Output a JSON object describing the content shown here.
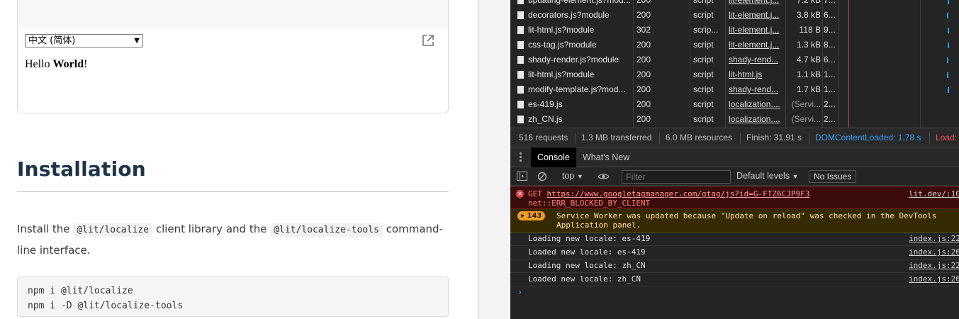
{
  "demo": {
    "locale_select_value": "中文 (简体)",
    "hello_prefix": "Hello ",
    "hello_bold": "World",
    "hello_suffix": "!"
  },
  "installation": {
    "heading": "Installation",
    "text_1": "Install the ",
    "code_1": "@lit/localize",
    "text_2": " client library and the ",
    "code_2": "@lit/localize-tools",
    "text_3": " command-line interface.",
    "code_block_lines": [
      "npm i @lit/localize",
      "npm i -D @lit/localize-tools"
    ]
  },
  "network": {
    "rows": [
      {
        "name": "updating-element.js?mod...",
        "status": "200",
        "type": "script",
        "initiator": "lit-element.j...",
        "size": "7.2 kB",
        "time": "7..."
      },
      {
        "name": "decorators.js?module",
        "status": "200",
        "type": "script",
        "initiator": "lit-element.j...",
        "size": "3.8 kB",
        "time": "6..."
      },
      {
        "name": "lit-html.js?module",
        "status": "302",
        "type": "scrip...",
        "initiator": "lit-element.j...",
        "size": "118 B",
        "time": "9..."
      },
      {
        "name": "css-tag.js?module",
        "status": "200",
        "type": "script",
        "initiator": "lit-element.j...",
        "size": "1.3 kB",
        "time": "8..."
      },
      {
        "name": "shady-render.js?module",
        "status": "200",
        "type": "script",
        "initiator": "shady-rend...",
        "size": "4.7 kB",
        "time": "6..."
      },
      {
        "name": "lit-html.js?module",
        "status": "200",
        "type": "script",
        "initiator": "lit-html.js",
        "size": "1.1 kB",
        "time": "1..."
      },
      {
        "name": "modify-template.js?mod...",
        "status": "200",
        "type": "script",
        "initiator": "shady-rend...",
        "size": "1.7 kB",
        "time": "1..."
      },
      {
        "name": "es-419.js",
        "status": "200",
        "type": "script",
        "initiator": "localization....",
        "size": "(Servi...",
        "time": "2..."
      },
      {
        "name": "zh_CN.js",
        "status": "200",
        "type": "script",
        "initiator": "localization....",
        "size": "(Servi...",
        "time": "2..."
      }
    ],
    "summary": {
      "requests": "516 requests",
      "transferred": "1.3 MB transferred",
      "resources": "6.0 MB resources",
      "finish": "Finish: 31.91 s",
      "dom_content_loaded": "DOMContentLoaded: 1.78 s",
      "load": "Load:"
    }
  },
  "drawer": {
    "tab_console": "Console",
    "tab_whats_new": "What's New"
  },
  "console_toolbar": {
    "context": "top",
    "filter_placeholder": "Filter",
    "levels": "Default levels",
    "issues": "No Issues"
  },
  "console": {
    "error": {
      "prefix": "GET ",
      "url": "https://www.googletagmanager.com/gtag/js?id=G-FTZ6CJP9F3",
      "line2": "net::ERR_BLOCKED_BY_CLIENT",
      "source": "lit.dev/:10"
    },
    "warning": {
      "count": "143",
      "line1": "Service Worker was updated because \"Update on reload\" was checked in the DevTools",
      "line2": "Application panel."
    },
    "logs": [
      {
        "text": "Loading new locale: es-419",
        "source": "index.js:22"
      },
      {
        "text": "Loaded new locale: es-419",
        "source": "index.js:26"
      },
      {
        "text": "Loading new locale: zh_CN",
        "source": "index.js:22"
      },
      {
        "text": "Loaded new locale: zh_CN",
        "source": "index.js:26"
      }
    ],
    "prompt": "›"
  },
  "colors": {
    "heading": "#1f3348",
    "devtools_bg": "#242424",
    "error_bg": "#3c0b0b",
    "warning_bg": "#362a05",
    "accent_blue": "#3a9bf0"
  }
}
